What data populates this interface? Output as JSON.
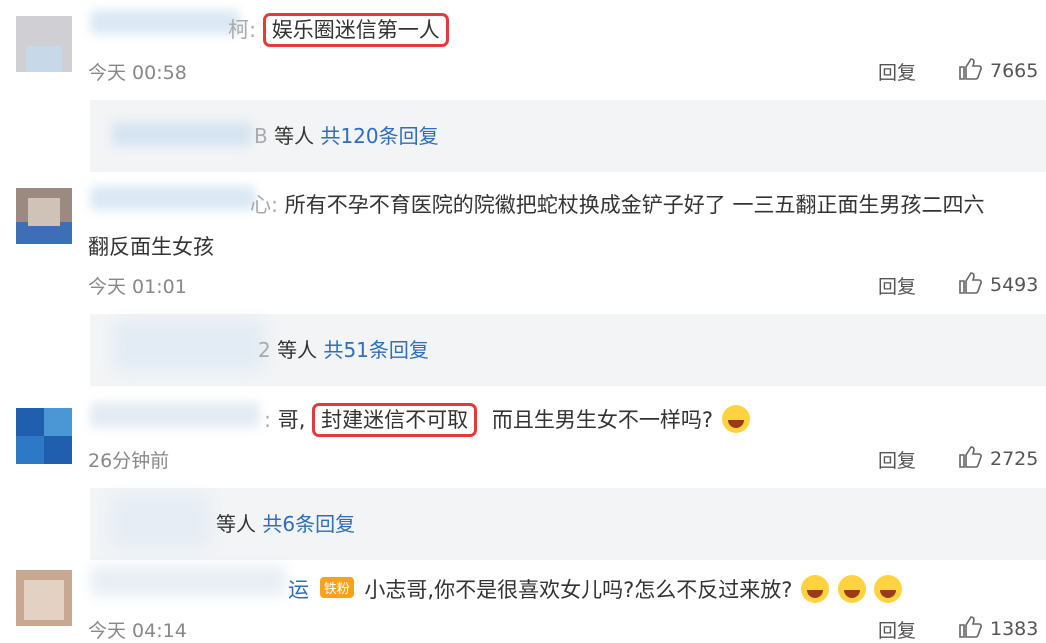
{
  "comments": [
    {
      "user_suffix": "柯:",
      "text": "娱乐圈迷信第一人",
      "time": "今天 00:58",
      "reply": "回复",
      "likes": "7665",
      "sub": {
        "prefix": "B",
        "mid": "等人",
        "count": "共120条回复"
      }
    },
    {
      "user_suffix": "心:",
      "text": "所有不孕不育医院的院徽把蛇杖换成金铲子好了 一三五翻正面生男孩二四六",
      "text2": "翻反面生女孩",
      "time": "今天 01:01",
      "reply": "回复",
      "likes": "5493",
      "sub": {
        "prefix": "2",
        "mid": "等人",
        "count": "共51条回复"
      }
    },
    {
      "user_suffix": ":",
      "pre": "哥,",
      "highlight": "封建迷信不可取",
      "text": "而且生男生女不一样吗?",
      "time": "26分钟前",
      "reply": "回复",
      "likes": "2725",
      "sub": {
        "prefix": "",
        "mid": "等人",
        "count": "共6条回复"
      }
    },
    {
      "user_suffix": "运",
      "badge": "铁粉",
      "text": "小志哥,你不是很喜欢女儿吗?怎么不反过来放?",
      "time": "今天 04:14",
      "reply": "回复",
      "likes": "1383"
    }
  ]
}
